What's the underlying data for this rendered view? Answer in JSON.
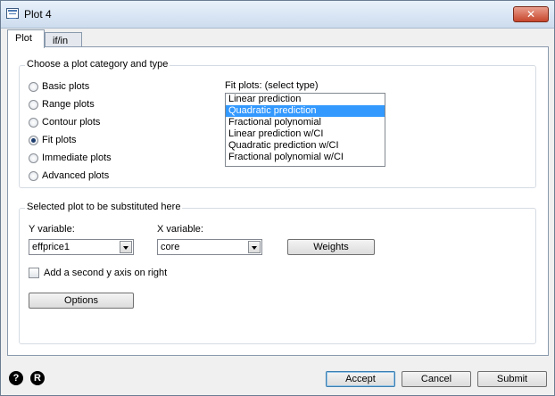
{
  "window": {
    "title": "Plot 4",
    "close_label": "✕"
  },
  "tabs": [
    {
      "label": "Plot",
      "active": true
    },
    {
      "label": "if/in",
      "active": false
    }
  ],
  "category_group": {
    "label": "Choose a plot category and type",
    "options": [
      {
        "label": "Basic plots",
        "selected": false
      },
      {
        "label": "Range plots",
        "selected": false
      },
      {
        "label": "Contour plots",
        "selected": false
      },
      {
        "label": "Fit plots",
        "selected": true
      },
      {
        "label": "Immediate plots",
        "selected": false
      },
      {
        "label": "Advanced plots",
        "selected": false
      }
    ],
    "fit_label": "Fit plots: (select type)",
    "fit_types": [
      "Linear prediction",
      "Quadratic prediction",
      "Fractional polynomial",
      "Linear prediction w/CI",
      "Quadratic prediction w/CI",
      "Fractional polynomial w/CI"
    ],
    "fit_selected_index": 1
  },
  "substitute_group": {
    "label": "Selected plot to be substituted here",
    "y_label": "Y variable:",
    "y_value": "effprice1",
    "x_label": "X variable:",
    "x_value": "core",
    "weights_label": "Weights",
    "second_axis_label": "Add a second y axis on right",
    "second_axis_checked": false,
    "options_label": "Options"
  },
  "footer": {
    "help_icon": "?",
    "reset_icon": "R",
    "accept_label": "Accept",
    "cancel_label": "Cancel",
    "submit_label": "Submit"
  }
}
